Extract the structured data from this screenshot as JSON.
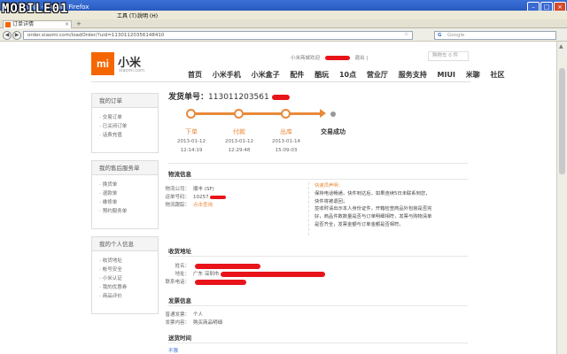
{
  "window": {
    "title": "订单详情 - Mozilla Firefox",
    "watermark": "MOBILE01"
  },
  "menubar": [
    "工具 (T)",
    "說明 (H)"
  ],
  "tab": {
    "label": "订单详情",
    "new_tab": "+"
  },
  "navbar": {
    "url": "order.xiaomi.com/loadOrder/?uid=11301120356148410",
    "search_placeholder": "Google",
    "search_engine": "G"
  },
  "header": {
    "user_prefix": "小米商城欢迎",
    "logout": "退出",
    "separator": "|",
    "cart": "购物车 0 件",
    "logo_text": "mi",
    "brand": "小米",
    "brand_sub": "xiaomi.com",
    "nav": [
      "首页",
      "小米手机",
      "小米盒子",
      "配件",
      "酷玩",
      "10点",
      "营业厅",
      "服务支持",
      "MIUI",
      "米聊",
      "社区"
    ]
  },
  "sidebar": {
    "orders": {
      "title": "我的订单",
      "items": [
        "交易订单",
        "已关闭订单",
        "话费充值"
      ]
    },
    "services": {
      "title": "我的售后服务单",
      "items": [
        "换货单",
        "退款单",
        "维修单",
        "预约服务单"
      ]
    },
    "personal": {
      "title": "我的个人信息",
      "items": [
        "收货地址",
        "帐号安全",
        "小米认证",
        "我的优惠券",
        "商品评价"
      ]
    }
  },
  "order": {
    "title_label": "发货单号：",
    "number": "113011203561",
    "steps": [
      {
        "label": "下单",
        "date": "2013-01-12",
        "time": "12:14:19"
      },
      {
        "label": "付款",
        "date": "2013-01-12",
        "time": "12:29:48"
      },
      {
        "label": "出库",
        "date": "2013-01-14",
        "time": "15:09:03"
      },
      {
        "label": "交易成功"
      }
    ]
  },
  "logistics": {
    "title": "物流信息",
    "company_label": "物流公司：",
    "company": "顺丰 (SF)",
    "tracking_label": "运单号码：",
    "tracking": "10257",
    "track_label": "物流跟踪：",
    "track_link": "点击查询",
    "tip_title": "快递员声明：",
    "tip_lines": [
      "保持电话畅通，快件到达后，如果连续5日未联系到您，",
      "快件将被退回；",
      "签收时请出示本人身份证件，开箱检查商品外包装是否完",
      "好，商品件数数量是否与订单明细相符，发票与购物清单",
      "是否齐全，发票金额与订单金额是否相符。"
    ]
  },
  "shipping": {
    "title": "收货地址",
    "name_label": "姓名：",
    "address_label": "地址：",
    "address_prefix": "广东 深圳市",
    "phone_label": "联系电话："
  },
  "invoice": {
    "title": "发票信息",
    "type_label": "普通发票：",
    "type": "个人",
    "content_label": "发票内容：",
    "content": "购买商品明细"
  },
  "delivery": {
    "title": "送货时间",
    "value": "不限"
  },
  "colors": {
    "accent": "#e88a3a",
    "brand": "#f56600",
    "redaction": "#e8141a"
  }
}
